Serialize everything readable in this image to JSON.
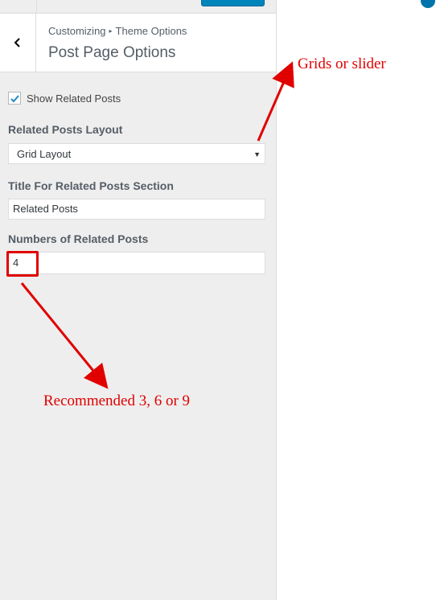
{
  "header": {
    "breadcrumb_root": "Customizing",
    "breadcrumb_current": "Theme Options",
    "title": "Post Page Options"
  },
  "controls": {
    "show_related_posts": {
      "label": "Show Related Posts",
      "checked": true
    },
    "layout": {
      "label": "Related Posts Layout",
      "value": "Grid Layout"
    },
    "section_title": {
      "label": "Title For Related Posts Section",
      "value": "Related Posts"
    },
    "count": {
      "label": "Numbers of Related Posts",
      "value": "4"
    }
  },
  "annotations": {
    "layout_note": "Grids or slider",
    "count_note": "Recommended 3, 6 or 9"
  },
  "colors": {
    "annotation": "#e00000",
    "accent": "#0085ba"
  }
}
